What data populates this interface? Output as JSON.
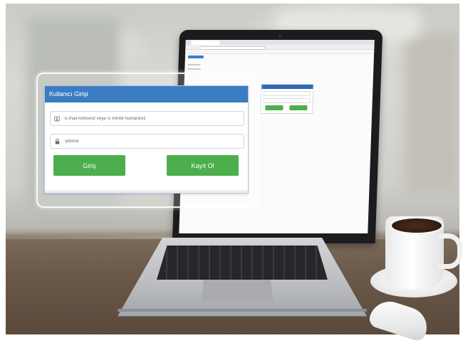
{
  "login_form": {
    "title": "Kullanıcı Girişi",
    "email_field": {
      "placeholder": "E-mail Adresiniz veya Tc Kimlik Numaranız",
      "value": ""
    },
    "password_field": {
      "placeholder": "Şifreniz",
      "value": ""
    },
    "login_button_label": "Giriş",
    "register_button_label": "Kayıt Ol"
  },
  "icons": {
    "email_field_icon": "user-card-icon",
    "password_field_icon": "lock-icon"
  },
  "colors": {
    "header_blue": "#3b7cc2",
    "button_green": "#4cae4c",
    "panel_border": "#b9c7da"
  }
}
